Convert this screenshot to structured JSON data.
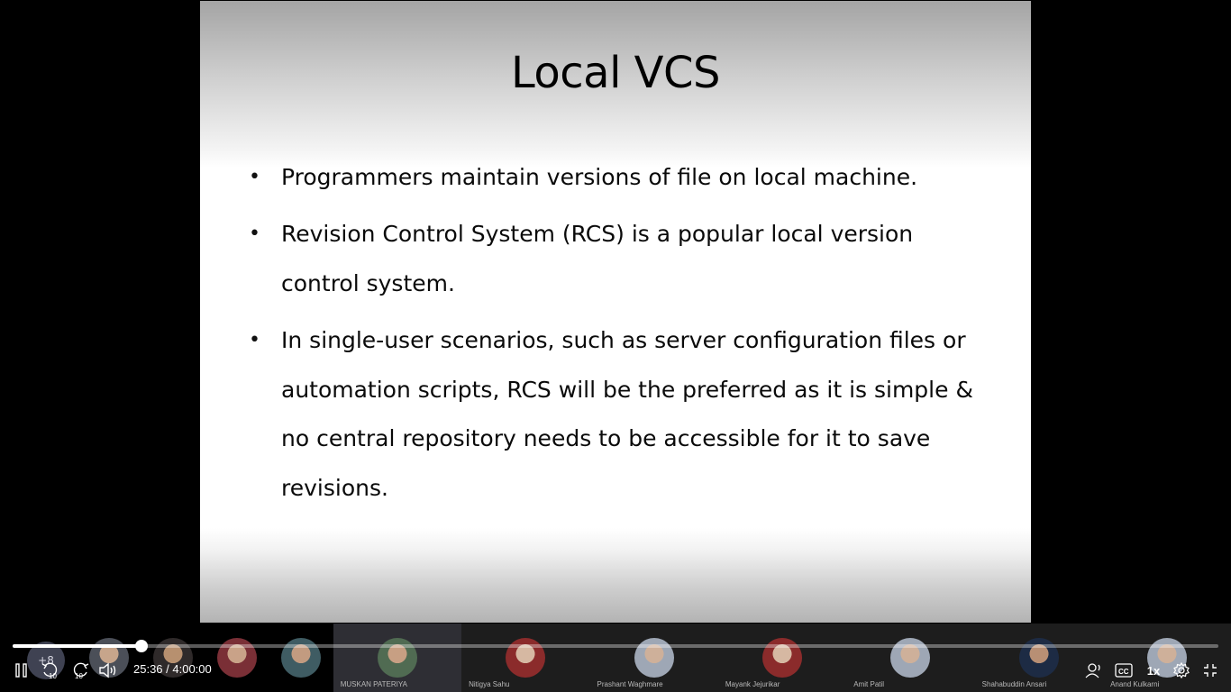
{
  "slide": {
    "title": "Local VCS",
    "bullets": [
      "Programmers maintain versions of file on local machine.",
      "Revision Control System (RCS) is a popular local version control system.",
      "In single-user scenarios, such as server configuration files or automation scripts, RCS will be the preferred as it is simple & no central repository needs to be accessible for it to save revisions."
    ],
    "bullet_symbol": "•"
  },
  "participants": {
    "overflow_count": "+8",
    "tiles": [
      {
        "name": ""
      },
      {
        "name": ""
      },
      {
        "name": "MUSKAN PATERIYA"
      },
      {
        "name": "Nitigya Sahu"
      },
      {
        "name": "Prashant Waghmare"
      },
      {
        "name": "Mayank Jejurikar"
      },
      {
        "name": "Amit Patil"
      },
      {
        "name": "Shahabuddin Ansari"
      },
      {
        "name": "Anand Kulkarni"
      }
    ]
  },
  "player": {
    "progress_fraction": 0.1067,
    "current_time": "25:36",
    "separator": "/",
    "duration": "4:00:00",
    "time_display": "25:36 / 4:00:00",
    "skip_back_seconds": "10",
    "skip_forward_seconds": "10",
    "playback_speed": "1x",
    "icons": [
      "pause-icon",
      "rewind-10-icon",
      "forward-10-icon",
      "volume-icon",
      "participants-audio-icon",
      "closed-captions-icon",
      "settings-gear-icon",
      "exit-fullscreen-icon"
    ]
  }
}
